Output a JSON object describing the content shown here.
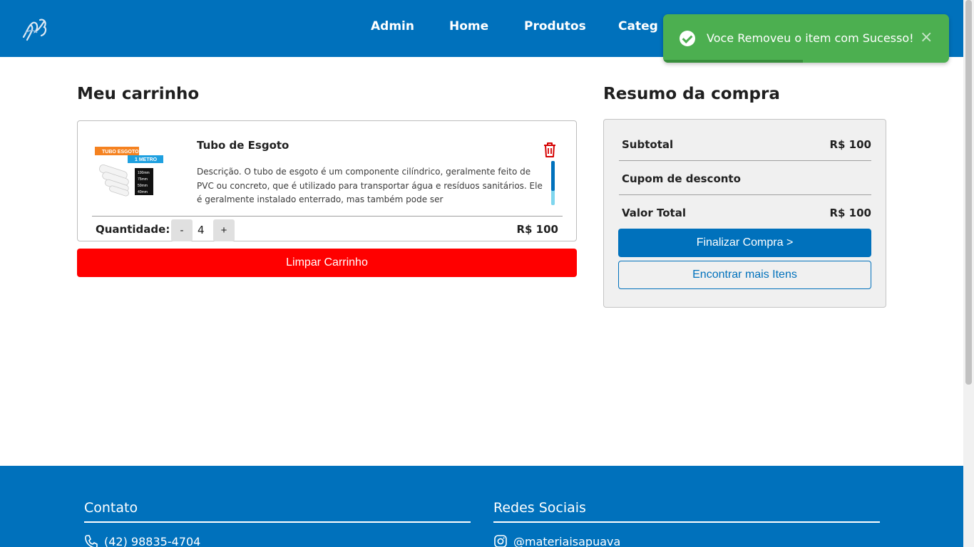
{
  "header": {
    "nav": [
      "Admin",
      "Home",
      "Produtos",
      "Categ"
    ]
  },
  "toast": {
    "message": "Voce Removeu o item com Sucesso!",
    "close": "×",
    "progress": 0.49
  },
  "cart": {
    "title": "Meu carrinho",
    "item": {
      "name": "Tubo de Esgoto",
      "image_labels": [
        "TUBO ESGOTO",
        "1 METRO",
        "100mm",
        "75mm",
        "50mm",
        "40mm"
      ],
      "description": "Descrição. O tubo de esgoto é um componente cilíndrico, geralmente feito de PVC ou concreto, que é utilizado para transportar água e resíduos sanitários. Ele é geralmente instalado enterrado, mas também pode ser",
      "qty_label": "Quantidade:",
      "minus": "-",
      "plus": "+",
      "quantity": "4",
      "price": "R$ 100"
    },
    "clear_label": "Limpar Carrinho"
  },
  "summary": {
    "title": "Resumo da compra",
    "subtotal_label": "Subtotal",
    "subtotal_value": "R$ 100",
    "coupon_label": "Cupom de desconto",
    "total_label": "Valor Total",
    "total_value": "R$ 100",
    "checkout_label": "Finalizar Compra >",
    "more_label": "Encontrar mais Itens"
  },
  "footer": {
    "contact_title": "Contato",
    "phone": "(42) 98835-4704",
    "social_title": "Redes Sociais",
    "instagram": "@materiaisapuava"
  }
}
